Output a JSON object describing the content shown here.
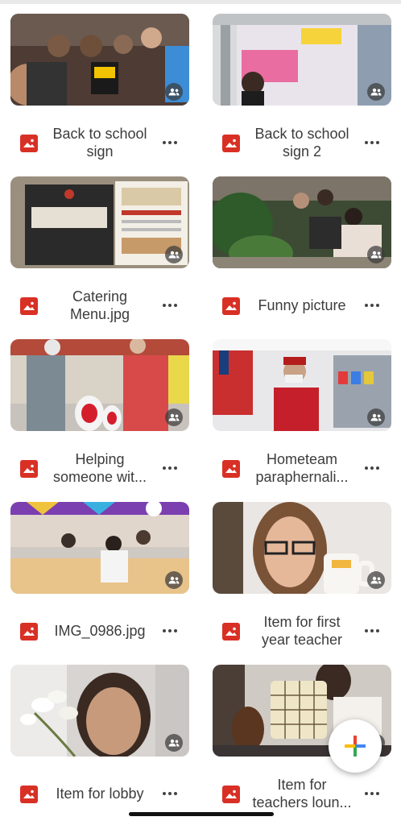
{
  "colors": {
    "image_type_icon": "#d93025",
    "fab_red": "#ea4335",
    "fab_blue": "#4285f4",
    "fab_green": "#34a853",
    "fab_yellow": "#fbbc04"
  },
  "files": [
    {
      "name": "Back to school sign",
      "type": "image",
      "shared": true
    },
    {
      "name": "Back to school sign 2",
      "type": "image",
      "shared": true
    },
    {
      "name": "Catering Menu.jpg",
      "type": "image",
      "shared": true
    },
    {
      "name": "Funny picture",
      "type": "image",
      "shared": true
    },
    {
      "name": "Helping someone wit...",
      "type": "image",
      "shared": true
    },
    {
      "name": "Hometeam paraphernali...",
      "type": "image",
      "shared": true
    },
    {
      "name": "IMG_0986.jpg",
      "type": "image",
      "shared": true
    },
    {
      "name": "Item for first year teacher",
      "type": "image",
      "shared": true
    },
    {
      "name": "Item for lobby",
      "type": "image",
      "shared": true
    },
    {
      "name": "Item for teachers loun...",
      "type": "image",
      "shared": true
    }
  ],
  "icons": {
    "image_type": "image-file-icon",
    "shared": "shared-people-icon",
    "more": "more-options-icon",
    "fab": "plus-icon"
  },
  "fab": {
    "label": "+"
  }
}
